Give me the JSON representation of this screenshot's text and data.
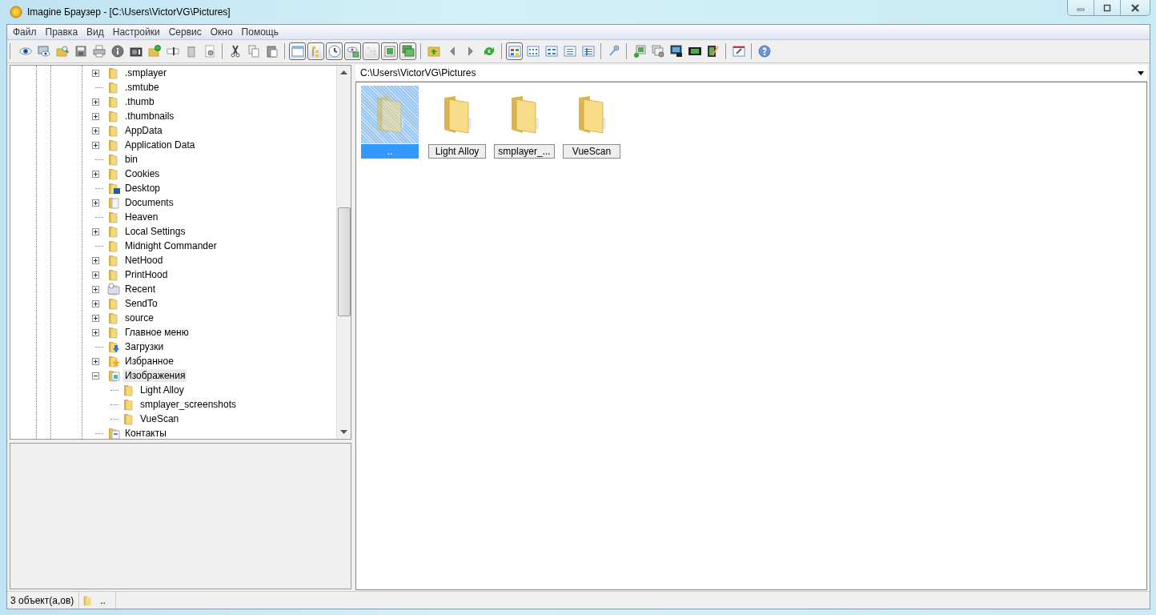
{
  "window": {
    "title": "Imagine Браузер - [C:\\Users\\VictorVG\\Pictures]"
  },
  "menu": [
    "Файл",
    "Правка",
    "Вид",
    "Настройки",
    "Сервис",
    "Окно",
    "Помощь"
  ],
  "toolbar": [
    [
      {
        "kind": "eye",
        "pressed": false
      },
      {
        "kind": "monitor-eye",
        "pressed": false
      },
      {
        "kind": "folder-magnifier",
        "pressed": false
      },
      {
        "kind": "floppy",
        "pressed": false
      },
      {
        "kind": "printer",
        "pressed": false
      },
      {
        "kind": "info",
        "pressed": false
      },
      {
        "kind": "camera",
        "pressed": false
      },
      {
        "kind": "folder-plus",
        "pressed": false
      },
      {
        "kind": "text-field",
        "pressed": false
      },
      {
        "kind": "trash",
        "pressed": false
      },
      {
        "kind": "gear-page",
        "pressed": false
      }
    ],
    [
      {
        "kind": "scissors",
        "pressed": false
      },
      {
        "kind": "copy",
        "pressed": false
      },
      {
        "kind": "paste",
        "pressed": false
      }
    ],
    [
      {
        "kind": "window",
        "pressed": true
      },
      {
        "kind": "tree",
        "pressed": true
      },
      {
        "kind": "clock",
        "pressed": true
      },
      {
        "kind": "eye-picture",
        "pressed": true
      },
      {
        "kind": "dots-grid",
        "pressed": true
      },
      {
        "kind": "picture-frame",
        "pressed": true
      },
      {
        "kind": "windows-stack",
        "pressed": true
      }
    ],
    [
      {
        "kind": "folder-up",
        "pressed": false
      },
      {
        "kind": "left-arrow",
        "pressed": false
      },
      {
        "kind": "right-arrow",
        "pressed": false
      },
      {
        "kind": "refresh",
        "pressed": false
      }
    ],
    [
      {
        "kind": "tiles",
        "pressed": true
      },
      {
        "kind": "icons-grid",
        "pressed": false
      },
      {
        "kind": "small-list",
        "pressed": false
      },
      {
        "kind": "list",
        "pressed": false
      },
      {
        "kind": "details",
        "pressed": false
      }
    ],
    [
      {
        "kind": "wrench",
        "pressed": false
      }
    ],
    [
      {
        "kind": "pictures-plus",
        "pressed": false
      },
      {
        "kind": "pictures-gear",
        "pressed": false
      },
      {
        "kind": "monitor-camera",
        "pressed": false
      },
      {
        "kind": "film",
        "pressed": false
      },
      {
        "kind": "film-pencil",
        "pressed": false
      }
    ],
    [
      {
        "kind": "window-clip",
        "pressed": false
      }
    ],
    [
      {
        "kind": "help",
        "pressed": false
      }
    ]
  ],
  "tree": [
    {
      "label": ".smplayer",
      "kind": "folder",
      "expanded": false,
      "selected": false
    },
    {
      "label": ".smtube",
      "kind": "folder",
      "selected": false
    },
    {
      "label": ".thumb",
      "kind": "folder",
      "expanded": false,
      "selected": false
    },
    {
      "label": ".thumbnails",
      "kind": "folder",
      "expanded": false,
      "selected": false
    },
    {
      "label": "AppData",
      "kind": "folder",
      "expanded": false,
      "selected": false
    },
    {
      "label": "Application Data",
      "kind": "folder",
      "expanded": false,
      "selected": false
    },
    {
      "label": "bin",
      "kind": "folder",
      "selected": false
    },
    {
      "label": "Cookies",
      "kind": "folder",
      "expanded": false,
      "selected": false
    },
    {
      "label": "Desktop",
      "kind": "desktop",
      "selected": false
    },
    {
      "label": "Documents",
      "kind": "documents",
      "expanded": false,
      "selected": false
    },
    {
      "label": "Heaven",
      "kind": "folder",
      "selected": false
    },
    {
      "label": "Local Settings",
      "kind": "folder",
      "expanded": false,
      "selected": false
    },
    {
      "label": "Midnight Commander",
      "kind": "folder",
      "selected": false
    },
    {
      "label": "NetHood",
      "kind": "folder",
      "expanded": false,
      "selected": false
    },
    {
      "label": "PrintHood",
      "kind": "folder",
      "expanded": false,
      "selected": false
    },
    {
      "label": "Recent",
      "kind": "recent",
      "expanded": false,
      "selected": false
    },
    {
      "label": "SendTo",
      "kind": "folder",
      "expanded": false,
      "selected": false
    },
    {
      "label": "source",
      "kind": "folder",
      "expanded": false,
      "selected": false
    },
    {
      "label": "Главное меню",
      "kind": "folder",
      "expanded": false,
      "selected": false
    },
    {
      "label": "Загрузки",
      "kind": "downloads",
      "selected": false
    },
    {
      "label": "Избранное",
      "kind": "favorites",
      "expanded": false,
      "selected": false
    },
    {
      "label": "Изображения",
      "kind": "pictures",
      "expanded": true,
      "selected": true,
      "children": [
        {
          "label": "Light Alloy",
          "selected": false
        },
        {
          "label": "smplayer_screenshots",
          "selected": false
        },
        {
          "label": "VueScan",
          "selected": false
        }
      ]
    },
    {
      "label": "Контакты",
      "kind": "contacts",
      "selected": false
    }
  ],
  "path": "C:\\Users\\VictorVG\\Pictures",
  "files": [
    {
      "name": "..",
      "kind": "parent",
      "selected": true
    },
    {
      "name": "Light Alloy",
      "kind": "folder",
      "selected": false
    },
    {
      "name": "smplayer_...",
      "kind": "folder",
      "selected": false
    },
    {
      "name": "VueScan",
      "kind": "folder",
      "selected": false
    }
  ],
  "status_bar": {
    "count": "3 объект(а,ов)",
    "current": ".."
  }
}
